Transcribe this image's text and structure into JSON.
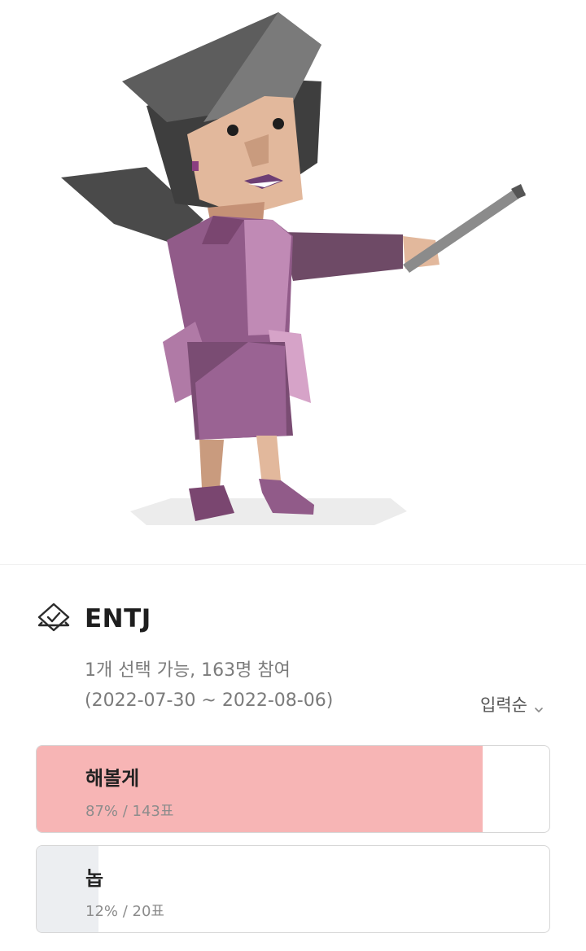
{
  "poll": {
    "title": "ENTJ",
    "meta_line1": "1개 선택 가능, 163명 참여",
    "meta_line2": "(2022-07-30 ~ 2022-08-06)",
    "sort_label": "입력순",
    "options": [
      {
        "label": "해볼게",
        "stat": "87% / 143표",
        "percent": 87,
        "fill_color": "#f7b5b5"
      },
      {
        "label": "놉",
        "stat": "12% / 20표",
        "percent": 12,
        "fill_color": "#eceef1"
      }
    ]
  },
  "icons": {
    "poll": "vote-check-icon",
    "sort": "chevron-down-icon"
  }
}
